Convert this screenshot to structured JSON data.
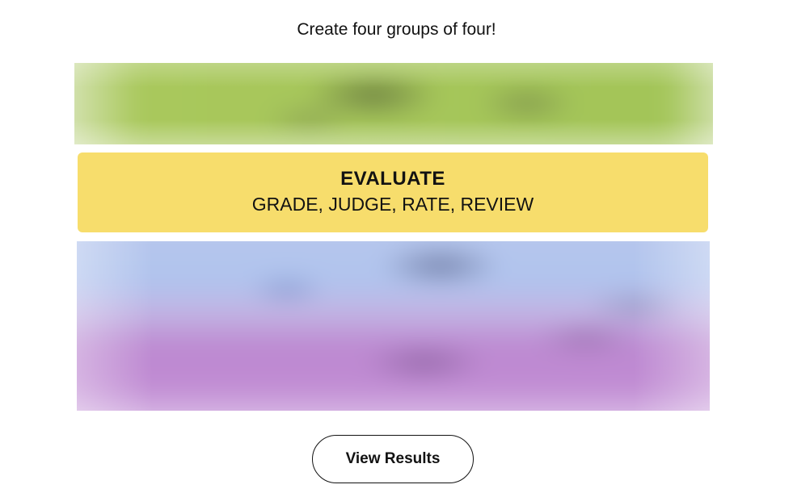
{
  "header": {
    "prompt": "Create four groups of four!"
  },
  "groups": [
    {
      "state": "hidden",
      "color": "#a3c558"
    },
    {
      "state": "solved",
      "color": "#f7dd6c",
      "title": "EVALUATE",
      "words": "GRADE, JUDGE, RATE, REVIEW"
    },
    {
      "state": "hidden",
      "color": "#b0c4ef"
    },
    {
      "state": "hidden",
      "color": "#bc70c4"
    }
  ],
  "actions": {
    "view_results_label": "View Results"
  }
}
